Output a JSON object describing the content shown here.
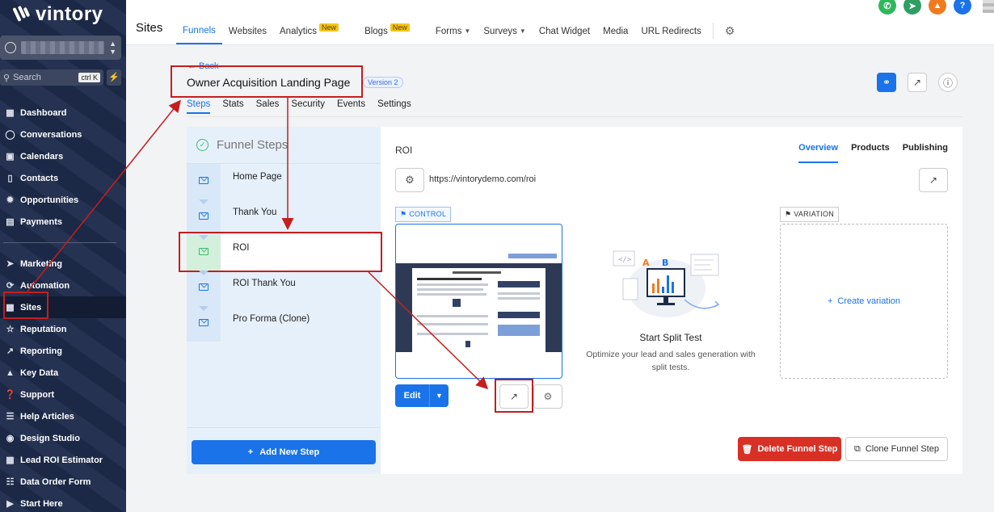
{
  "brand": {
    "name": "vintory"
  },
  "sidebar": {
    "search_placeholder": "Search",
    "search_shortcut": "ctrl K",
    "items": [
      {
        "label": "Dashboard",
        "icon": "dashboard-icon"
      },
      {
        "label": "Conversations",
        "icon": "chat-icon"
      },
      {
        "label": "Calendars",
        "icon": "calendar-icon"
      },
      {
        "label": "Contacts",
        "icon": "contacts-icon"
      },
      {
        "label": "Opportunities",
        "icon": "opportunities-icon"
      },
      {
        "label": "Payments",
        "icon": "payments-icon"
      },
      {
        "label": "Marketing",
        "icon": "send-icon"
      },
      {
        "label": "Automation",
        "icon": "automation-icon"
      },
      {
        "label": "Sites",
        "icon": "sites-icon"
      },
      {
        "label": "Reputation",
        "icon": "star-icon"
      },
      {
        "label": "Reporting",
        "icon": "reporting-icon"
      },
      {
        "label": "Key Data",
        "icon": "chart-icon"
      },
      {
        "label": "Support",
        "icon": "help-icon"
      },
      {
        "label": "Help Articles",
        "icon": "articles-icon"
      },
      {
        "label": "Design Studio",
        "icon": "palette-icon"
      },
      {
        "label": "Lead ROI Estimator",
        "icon": "calculator-icon"
      },
      {
        "label": "Data Order Form",
        "icon": "database-icon"
      },
      {
        "label": "Start Here",
        "icon": "play-icon"
      }
    ]
  },
  "topbar": {
    "section_title": "Sites",
    "tabs": [
      {
        "label": "Funnels"
      },
      {
        "label": "Websites"
      },
      {
        "label": "Analytics",
        "badge": "New"
      },
      {
        "label": "Blogs",
        "badge": "New"
      },
      {
        "label": "Forms"
      },
      {
        "label": "Surveys"
      },
      {
        "label": "Chat Widget"
      },
      {
        "label": "Media"
      },
      {
        "label": "URL Redirects"
      }
    ],
    "help_label": "?"
  },
  "page": {
    "back_label": "← Back",
    "title": "Owner Acquisition Landing Page",
    "version": "Version 2",
    "subtabs": [
      "Steps",
      "Stats",
      "Sales",
      "Security",
      "Events",
      "Settings"
    ]
  },
  "steps_panel": {
    "title": "Funnel Steps",
    "steps": [
      "Home Page",
      "Thank You",
      "ROI",
      "ROI Thank You",
      "Pro Forma (Clone)"
    ],
    "add_label": "Add New Step"
  },
  "main": {
    "step_name": "ROI",
    "tabs": [
      "Overview",
      "Products",
      "Publishing"
    ],
    "url": "https://vintorydemo.com/roi",
    "control_label": "CONTROL",
    "variation_label": "VARIATION",
    "edit_label": "Edit",
    "split_title": "Start Split Test",
    "split_subtitle": "Optimize your lead and sales generation with split tests.",
    "create_variation": "Create variation",
    "delete_label": "Delete Funnel Step",
    "clone_label": "Clone Funnel Step"
  },
  "colors": {
    "accent": "#1a73e8",
    "danger": "#d93025",
    "annotation": "#c41e1e",
    "sidebar": "#1d2a4a"
  }
}
